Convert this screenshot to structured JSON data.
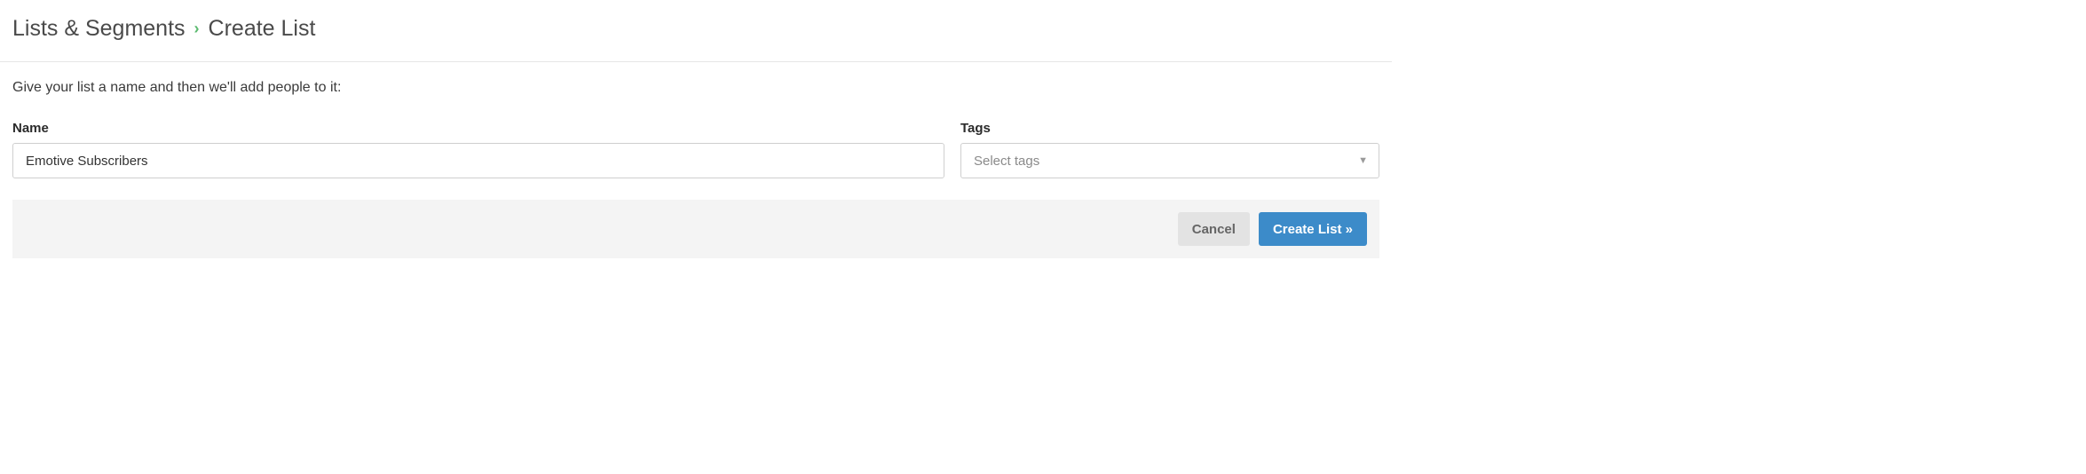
{
  "breadcrumb": {
    "parent": "Lists & Segments",
    "separator": "›",
    "current": "Create List"
  },
  "intro_text": "Give your list a name and then we'll add people to it:",
  "form": {
    "name_label": "Name",
    "name_value": "Emotive Subscribers",
    "tags_label": "Tags",
    "tags_placeholder": "Select tags"
  },
  "actions": {
    "cancel_label": "Cancel",
    "submit_label": "Create List »"
  }
}
